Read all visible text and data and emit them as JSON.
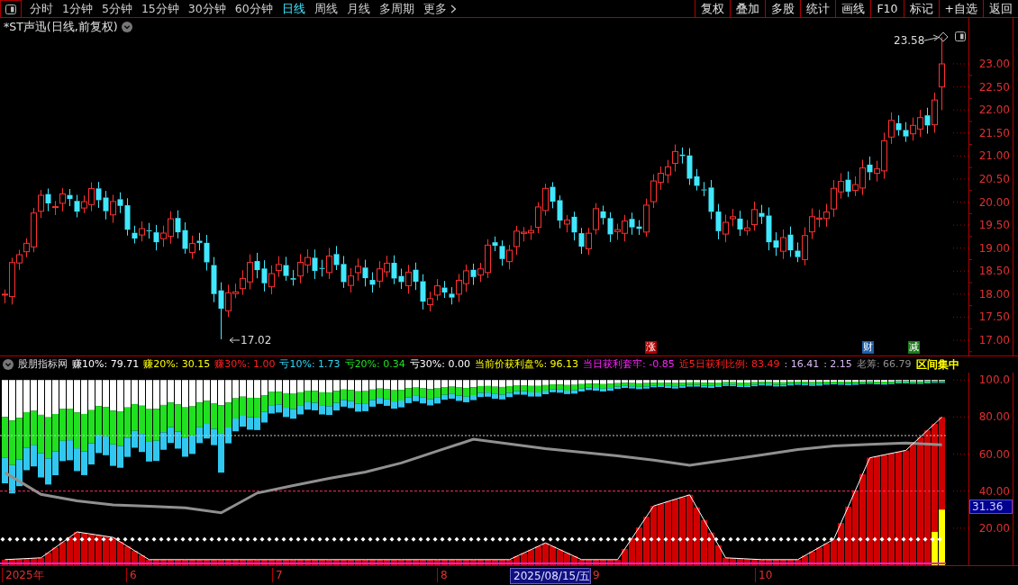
{
  "toolbar": {
    "period_tabs": [
      {
        "label": "分时",
        "selected": false
      },
      {
        "label": "1分钟",
        "selected": false
      },
      {
        "label": "5分钟",
        "selected": false
      },
      {
        "label": "15分钟",
        "selected": false
      },
      {
        "label": "30分钟",
        "selected": false
      },
      {
        "label": "60分钟",
        "selected": false
      },
      {
        "label": "日线",
        "selected": true
      },
      {
        "label": "周线",
        "selected": false
      },
      {
        "label": "月线",
        "selected": false
      },
      {
        "label": "多周期",
        "selected": false
      },
      {
        "label": "更多",
        "selected": false
      }
    ],
    "buttons": [
      "复权",
      "叠加",
      "多股",
      "统计",
      "画线",
      "F10",
      "标记",
      "+自选",
      "返回"
    ]
  },
  "chart": {
    "title": "*ST声迅(日线,前复权)",
    "high_label": "23.58",
    "low_label": "17.02",
    "event_badges": [
      {
        "text": "涨",
        "color": "#b00000"
      },
      {
        "text": "财",
        "color": "#1f5fa8"
      },
      {
        "text": "减",
        "color": "#1c7a1c"
      }
    ],
    "price_axis": [
      "23.00",
      "22.50",
      "22.00",
      "21.50",
      "21.00",
      "20.50",
      "20.00",
      "19.50",
      "19.00",
      "18.50",
      "18.00",
      "17.50",
      "17.00"
    ]
  },
  "indicator": {
    "name": "股朋指标网",
    "readouts": [
      {
        "text": "赚10%: 79.71",
        "color": "#ffffff"
      },
      {
        "text": "赚20%: 30.15",
        "color": "#ffff00"
      },
      {
        "text": "赚30%: 1.00",
        "color": "#ff2020"
      },
      {
        "text": "亏10%: 1.73",
        "color": "#30d8f8"
      },
      {
        "text": "亏20%: 0.34",
        "color": "#20e020"
      },
      {
        "text": "亏30%: 0.00",
        "color": "#ffffff"
      },
      {
        "text": "当前价获利盘%: 96.13",
        "color": "#ffff00"
      },
      {
        "text": "当日获利套牢: -0.85",
        "color": "#ff20ff"
      },
      {
        "text": "近5日获利比例: 83.49",
        "color": "#ff2020"
      },
      {
        "text": ": 16.41",
        "color": "#d8b8f0"
      },
      {
        "text": ": 2.15",
        "color": "#d8b8f0"
      },
      {
        "text": "老筹: 66.79",
        "color": "#909090"
      },
      {
        "text": "区间集中",
        "color": "#ffff00"
      }
    ],
    "chart_data": {
      "type": "line",
      "ylim": [
        0,
        104
      ],
      "yticks": [
        {
          "value": 100,
          "label": "100.0"
        },
        {
          "value": 80,
          "label": "80.00"
        },
        {
          "value": 60,
          "label": "60.00"
        },
        {
          "value": 40,
          "label": "40.00"
        },
        {
          "value": 20,
          "label": "20.00"
        }
      ],
      "series": [
        {
          "color": "#909090",
          "values": [
            50,
            38.3,
            34.8,
            32.6,
            31.8,
            31,
            28.3,
            39,
            43,
            46.9,
            50.3,
            55.2,
            61.6,
            68,
            65.5,
            63,
            61,
            59,
            56.7,
            54,
            56.7,
            59.5,
            62.5,
            64.4,
            65.2,
            66,
            65
          ]
        },
        {
          "color": "#ffffff",
          "values": [
            3,
            4,
            18,
            15,
            3,
            3,
            3,
            3,
            3,
            3,
            3,
            3,
            3,
            3,
            3,
            12,
            3,
            3,
            32,
            38,
            4,
            3,
            3,
            14,
            58,
            62,
            80
          ]
        }
      ]
    },
    "current_value": "31.36"
  },
  "date_axis": [
    {
      "text": "2025年",
      "selected": false
    },
    {
      "text": "6",
      "selected": false
    },
    {
      "text": "7",
      "selected": false
    },
    {
      "text": "8",
      "selected": false
    },
    {
      "text": "2025/08/15/五",
      "selected": true
    },
    {
      "text": "9",
      "selected": false
    },
    {
      "text": "10",
      "selected": false
    }
  ]
}
